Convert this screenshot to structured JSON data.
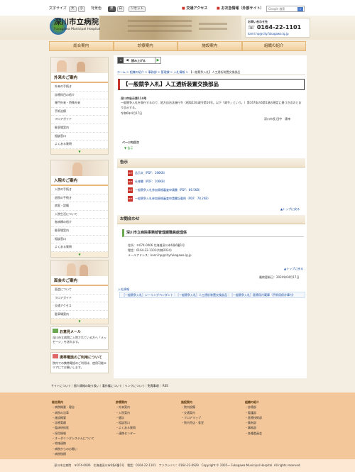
{
  "topbar": {
    "font_size_label": "文字サイズ",
    "font_buttons": [
      "大",
      "小"
    ],
    "bg_label": "背景色",
    "bg_buttons": [
      "黒",
      "白"
    ],
    "reset_label": "リセット",
    "access_label": "交通アクセス",
    "urgent_label": "お次急情報（外部サイト）",
    "search_placeholder": "Google 検索"
  },
  "header": {
    "site_title": "深川市立病院",
    "site_subtitle": "Fukagawa Municipal Hospital",
    "contact_label": "お問い合わせ先",
    "phone": "0164-22-1101",
    "email": "kanri.hp@city.fukagawa.lg.jp"
  },
  "nav": {
    "items": [
      "総合案内",
      "診療案内",
      "施設案内",
      "組織の紹介"
    ]
  },
  "sidebar": {
    "outpatient": {
      "title": "外来のご案内",
      "items": [
        "外来の手続き",
        "診療科目の紹介",
        "専門外来・特殊外来",
        "手術治療",
        "フロアガイド",
        "駐車場案内",
        "相談窓口",
        "よくある質問"
      ]
    },
    "inpatient": {
      "title": "入院のご案内",
      "items": [
        "入院の手続き",
        "退院の手続き",
        "病室・設備",
        "入院生活について",
        "各病棟の紹介",
        "駐車場案内",
        "相談窓口",
        "よくある質問"
      ]
    },
    "visit": {
      "title": "面会のご案内",
      "items": [
        "面会について",
        "フロアガイド",
        "交通アクセス",
        "駐車場案内"
      ]
    },
    "opinion": {
      "title": "お意見メール",
      "body": "深川市立病院に入院されている方へ「メッセージ」を送れます。"
    },
    "mobile": {
      "title": "携帯電話のご利用について",
      "body": "院内での携帯電話のご利用は、使用可能エリアにてお願いします。"
    },
    "more": "▼"
  },
  "main": {
    "toolbar_label": "読み上げる",
    "breadcrumb": [
      "ホーム",
      "組織の紹介",
      "事務部",
      "管理課",
      "入札情報",
      "【一般競争入札】人工透析装置交換部品"
    ],
    "title": "【一般競争入札】人工透析装置交換部品",
    "notice_number": "深川市告示第114号",
    "notice_body": "一般競争入札を執行するので、地方自治法施行令（昭和22年政令第16号。以下「政令」という。）第167条の6第1項の規定に基づき次のとおり告示する。",
    "notice_date": "令和6年4月17日",
    "signer": "深川市長 田中　康幸",
    "page_index_label": "ページ内目次",
    "page_index_item": "▼ 告示",
    "section_notice": "告示",
    "attachments": [
      "告示文（PDF：186KB）",
      "仕様書（PDF：106KB）",
      "一般競争入札参加資格審査申請書（PDF：86.5KB）",
      "一般競争入札参加資格審査申請書記載例（PDF：78.2KB）"
    ],
    "to_top": "▲トップに戻る",
    "section_contact": "お問合わせ",
    "contact_dept": "深川市立病院事務部管理課職員総理係",
    "contact_address": "住所：〒074-0006 北海道深川市6条6番1号",
    "contact_phone": "電話：0164-22-1101(内線2034)",
    "contact_mail": "メールアドレス：kanri.hp@city.fukagawa.lg.jp",
    "updated": "最終更新日：2024年04月17日",
    "related_label": "入札情報",
    "related_links": "［一般競争入札］シーリングペンダント｜［一般競争入札］人工透析装置交換部品｜［一般競争入札］医療用冷蔵庫（手術用保冷庫付）"
  },
  "footer": {
    "links": "サイトについて｜個人情報の取り扱い｜著作権について｜リンクについて｜免責事項｜ RSS",
    "cols": [
      {
        "title": "総合案内",
        "items": [
          "・病院概要・理念",
          "・病院の沿革",
          "・施設概要",
          "・診療実績",
          "・臨床研修医",
          "・採用情報",
          "・オーダリングシステムについて",
          "・地域連携",
          "・病院からのお願い",
          "・病院指標"
        ]
      },
      {
        "title": "診療案内",
        "items": [
          "・外来案内",
          "・入院案内",
          "・健診",
          "・相談窓口",
          "・よくある質問",
          "・連携センター"
        ]
      },
      {
        "title": "施設案内",
        "items": [
          "・院内設備",
          "・交通案内",
          "・フロアマップ",
          "・院内売店・食堂"
        ]
      },
      {
        "title": "組織の紹介",
        "items": [
          "・診療部",
          "・看護部",
          "・医療技術部",
          "・薬剤部",
          "・事務部",
          "・各種委員会"
        ]
      }
    ],
    "copyright": "深川市立病院　〒074-0006　北海道深川市6条6番1号　電話：0164-22-1101　ファクシミリ：0164-22-0929　Copyright © 2005～ Fukagawa Municipal Hospital. All rights reserved."
  }
}
